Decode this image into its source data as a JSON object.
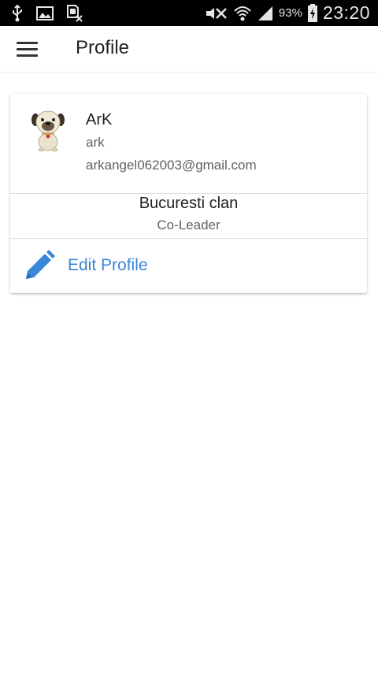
{
  "status_bar": {
    "icons_left": [
      "usb-icon",
      "image-icon",
      "sim-x-icon"
    ],
    "icons_right": [
      "mute-icon",
      "wifi-icon",
      "signal-icon",
      "battery-charging-icon"
    ],
    "battery_percent": "93%",
    "time": "23:20"
  },
  "app_bar": {
    "menu_icon": "hamburger-menu-icon",
    "title": "Profile"
  },
  "profile": {
    "avatar": "dog-avatar",
    "name": "ArK",
    "username": "ark",
    "email": "arkangel062003@gmail.com"
  },
  "clan": {
    "name": "Bucuresti clan",
    "role": "Co-Leader"
  },
  "actions": {
    "edit_icon": "pencil-icon",
    "edit_label": "Edit Profile"
  },
  "colors": {
    "accent": "#3a86d8",
    "status_bar": "#000000",
    "background": "#ffffff"
  }
}
